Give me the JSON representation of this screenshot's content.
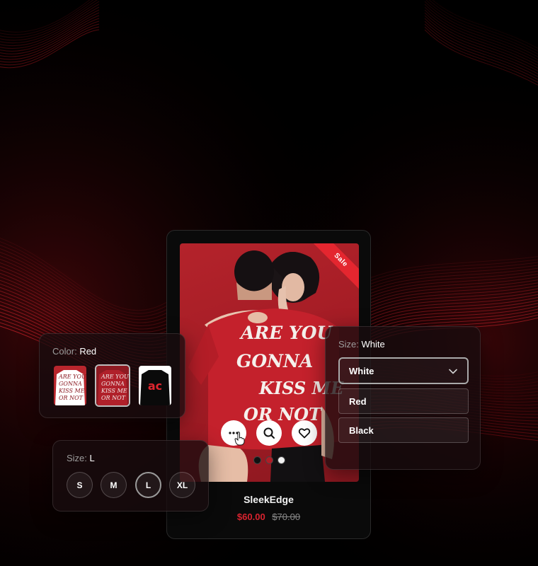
{
  "product": {
    "name": "SleekEdge",
    "sale_badge": "Sale",
    "price": "$60.00",
    "old_price": "$70.00",
    "shirt_text": [
      "ARE YOU",
      "GONNA",
      "KISS ME",
      "OR NOT"
    ],
    "image_dots": [
      {
        "color": "#111111",
        "active": false
      },
      {
        "color": "#b01c26",
        "active": true
      },
      {
        "color": "#f2f2f2",
        "active": false
      }
    ],
    "actions": [
      {
        "name": "more-options-icon"
      },
      {
        "name": "search-icon"
      },
      {
        "name": "heart-icon"
      }
    ]
  },
  "color_selector": {
    "label": "Color:",
    "value": "Red",
    "swatch_thumb_text": [
      "ARE YOU",
      "GONNA",
      "KISS ME",
      "OR NOT"
    ],
    "swatches": [
      {
        "name": "White",
        "shirt_color": "#ffffff",
        "selected": false
      },
      {
        "name": "Red",
        "shirt_color": "#b0202a",
        "selected": true
      },
      {
        "name": "Black",
        "shirt_color": "#0a0a0a",
        "selected": false
      }
    ]
  },
  "size_selector": {
    "label": "Size:",
    "value": "L",
    "sizes": [
      "S",
      "M",
      "L",
      "XL"
    ],
    "selected": "L"
  },
  "size_dropdown": {
    "label": "Size:",
    "value": "White",
    "selected": "White",
    "options": [
      "Red",
      "Black"
    ]
  },
  "colors": {
    "accent": "#d8232f",
    "background": "#000000"
  }
}
